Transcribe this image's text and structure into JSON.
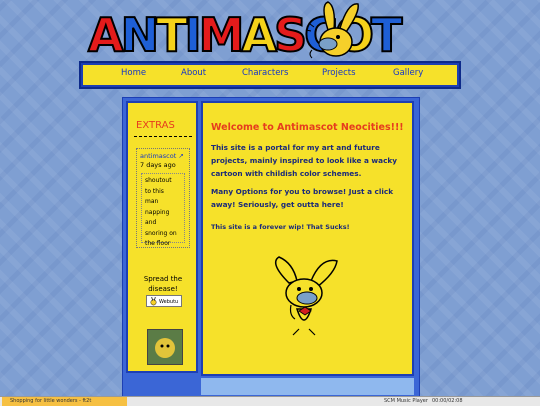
{
  "logo": {
    "text": "ANTIMASCOT",
    "letters": [
      "A",
      "N",
      "T",
      "I",
      "M",
      "A",
      "S",
      "C",
      "O",
      "T"
    ]
  },
  "nav": {
    "items": [
      "Home",
      "About",
      "Characters",
      "Projects",
      "Gallery"
    ]
  },
  "sidebar": {
    "title": "EXTRAS",
    "status": {
      "author": "antimascot",
      "author_icon": "link-icon",
      "when": "7 days ago",
      "lines": [
        "shoutout",
        "to this",
        "man",
        "napping",
        "and",
        "snoring on",
        "the floor"
      ]
    },
    "spread_line1": "Spread the",
    "spread_line2": "disease!",
    "webutu_label": "Webutu"
  },
  "content": {
    "welcome": "Welcome to Antimascot Neocities!!!",
    "para1": "This site is a portal for my art and future projects, mainly inspired to look like a wacky cartoon with childish color schemes.",
    "para2": "Many Options for you to browse! Just a click away! Seriously, get outta here!",
    "para3": "This site is a forever wip! That Sucks!"
  },
  "player": {
    "track": "Shopping for little wonders - ft2t",
    "player_name": "SCM Music Player",
    "time": "00:00/02:08"
  },
  "colors": {
    "background": "#7f9fd2",
    "panel": "#f6e12a",
    "border": "#1d3fb4",
    "accent_red": "#e63c1e",
    "link_blue": "#1436c8"
  }
}
